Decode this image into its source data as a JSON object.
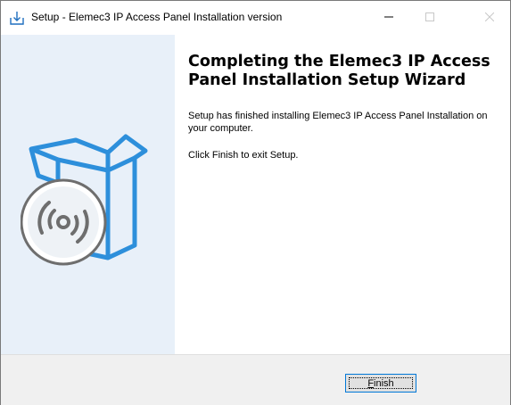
{
  "window": {
    "title": "Setup - Elemec3 IP Access Panel Installation version",
    "icon": "installer-download-icon",
    "controls": [
      "minimize-icon",
      "maximize-icon",
      "close-icon"
    ]
  },
  "content": {
    "heading": "Completing the Elemec3 IP Access Panel Installation Setup Wizard",
    "paragraph1": "Setup has finished installing Elemec3 IP Access Panel Installation on your computer.",
    "paragraph2": "Click Finish to exit Setup."
  },
  "footer": {
    "finish_mnemonic": "F",
    "finish_rest": "inish"
  },
  "colors": {
    "side_panel": "#e8f0f9",
    "box_blue": "#2d8fdb",
    "disc_gray": "#6e6e6e",
    "focus_border": "#0078d7"
  }
}
